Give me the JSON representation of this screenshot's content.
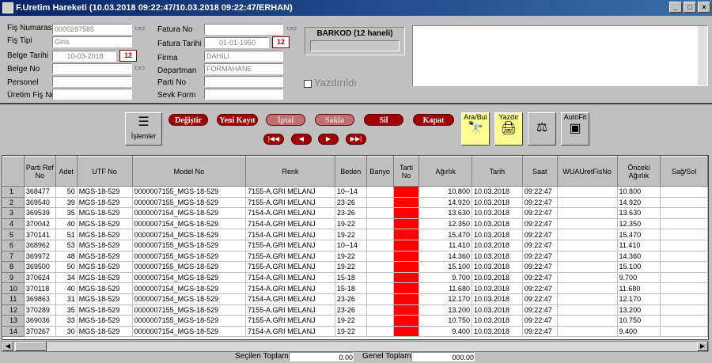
{
  "window": {
    "title": "F.Uretim Hareketi (10.03.2018 09:22:47/10.03.2018 09:22:47/ERHAN)"
  },
  "form": {
    "fis_numarasi_label": "Fiş Numarası",
    "fis_numarasi": "0000287585",
    "fis_tipi_label": "Fiş Tipi",
    "fis_tipi": "Giris",
    "belge_tarihi_label": "Belge Tarihi",
    "belge_tarihi": "10-03-2018",
    "belge_no_label": "Belge No",
    "belge_no": "",
    "personel_label": "Personel",
    "personel": "",
    "uretim_fis_no_label": "Üretim Fiş No",
    "uretim_fis_no": "",
    "fatura_no_label": "Fatura No",
    "fatura_no": "",
    "fatura_tarihi_label": "Fatura Tarihi",
    "fatura_tarihi": "01-01-1950",
    "firma_label": "Firma",
    "firma": "DAHILI",
    "departman_label": "Departman",
    "departman": "FORMAHANE",
    "parti_no_label": "Parti No",
    "parti_no": "",
    "sevk_form_label": "Sevk Form",
    "sevk_form": "",
    "barkod_label": "BARKOD (12 haneli)",
    "yazdirildi_label": "Yazdırıldı",
    "calendar_label": "12"
  },
  "toolbar": {
    "islemler": "İşlemler",
    "degistir": "Değiştir",
    "yeni_kayit": "Yeni Kayıt",
    "iptal": "İptal",
    "sakla": "Sakla",
    "sil": "Sil",
    "kapat": "Kapat",
    "ara_bul": "Ara/Bul",
    "yazdir": "Yazdır",
    "autofit": "AutoFit"
  },
  "grid": {
    "columns": [
      "Parti Ref No",
      "Adet",
      "UTF No",
      "Model No",
      "Renk",
      "Beden",
      "Banyo",
      "Tarti No",
      "Ağırlık",
      "Tarih",
      "Saat",
      "WUAUretFisNo",
      "Önceki Ağırlık",
      "Sağ/Sol"
    ],
    "rows": [
      [
        "1",
        "368477",
        "50",
        "MGS-18-529",
        "0000007155_MGS-18-529",
        "7155-A.GRI MELANJ",
        "10--14",
        "",
        "",
        "10.800",
        "10.03.2018",
        "09:22:47",
        "",
        "10.800",
        ""
      ],
      [
        "2",
        "369540",
        "39",
        "MGS-18-529",
        "0000007155_MGS-18-529",
        "7155-A.GRI MELANJ",
        "23-26",
        "",
        "",
        "14.920",
        "10.03.2018",
        "09:22:47",
        "",
        "14.920",
        ""
      ],
      [
        "3",
        "369539",
        "35",
        "MGS-18-529",
        "0000007154_MGS-18-529",
        "7154-A.GRI MELANJ",
        "23-26",
        "",
        "",
        "13.630",
        "10.03.2018",
        "09:22:47",
        "",
        "13.630",
        ""
      ],
      [
        "4",
        "370042",
        "40",
        "MGS-18-529",
        "0000007154_MGS-18-529",
        "7154-A.GRI MELANJ",
        "19-22",
        "",
        "",
        "12.350",
        "10.03.2018",
        "09:22:47",
        "",
        "12.350",
        ""
      ],
      [
        "5",
        "370141",
        "51",
        "MGS-18-529",
        "0000007154_MGS-18-529",
        "7154-A.GRI MELANJ",
        "19-22",
        "",
        "",
        "15.470",
        "10.03.2018",
        "09:22:47",
        "",
        "15.470",
        ""
      ],
      [
        "6",
        "368962",
        "53",
        "MGS-18-529",
        "0000007155_MGS-18-529",
        "7155-A.GRI MELANJ",
        "10--14",
        "",
        "",
        "11.410",
        "10.03.2018",
        "09:22:47",
        "",
        "11.410",
        ""
      ],
      [
        "7",
        "369972",
        "48",
        "MGS-18-529",
        "0000007155_MGS-18-529",
        "7155-A.GRI MELANJ",
        "19-22",
        "",
        "",
        "14.360",
        "10.03.2018",
        "09:22:47",
        "",
        "14.360",
        ""
      ],
      [
        "8",
        "369500",
        "50",
        "MGS-18-529",
        "0000007155_MGS-18-529",
        "7155-A.GRI MELANJ",
        "19-22",
        "",
        "",
        "15.100",
        "10.03.2018",
        "09:22:47",
        "",
        "15.100",
        ""
      ],
      [
        "9",
        "370624",
        "34",
        "MGS-18-529",
        "0000007154_MGS-18-529",
        "7154-A.GRI MELANJ",
        "15-18",
        "",
        "",
        "9.700",
        "10.03.2018",
        "09:22:47",
        "",
        "9.700",
        ""
      ],
      [
        "10",
        "370118",
        "40",
        "MGS-18-529",
        "0000007154_MGS-18-529",
        "7154-A.GRI MELANJ",
        "15-18",
        "",
        "",
        "11.680",
        "10.03.2018",
        "09:22:47",
        "",
        "11.680",
        ""
      ],
      [
        "11",
        "369863",
        "31",
        "MGS-18-529",
        "0000007154_MGS-18-529",
        "7154-A.GRI MELANJ",
        "23-26",
        "",
        "",
        "12.170",
        "10.03.2018",
        "09:22:47",
        "",
        "12.170",
        ""
      ],
      [
        "12",
        "370289",
        "35",
        "MGS-18-529",
        "0000007155_MGS-18-529",
        "7155-A.GRI MELANJ",
        "23-26",
        "",
        "",
        "13.200",
        "10.03.2018",
        "09:22:47",
        "",
        "13.200",
        ""
      ],
      [
        "13",
        "369036",
        "33",
        "MGS-18-529",
        "0000007155_MGS-18-529",
        "7155-A.GRI MELANJ",
        "19-22",
        "",
        "",
        "10.750",
        "10.03.2018",
        "09:22:47",
        "",
        "10.750",
        ""
      ],
      [
        "14",
        "370267",
        "30",
        "MGS-18-529",
        "0000007154_MGS-18-529",
        "7154-A.GRI MELANJ",
        "19-22",
        "",
        "",
        "9.400",
        "10.03.2018",
        "09:22:47",
        "",
        "9.400",
        ""
      ]
    ]
  },
  "footer": {
    "secilen_toplam": "Seçilen Toplam",
    "secilen_value": "0.00",
    "genel_toplam": "Genel Toplam",
    "genel_value": "000.00"
  }
}
